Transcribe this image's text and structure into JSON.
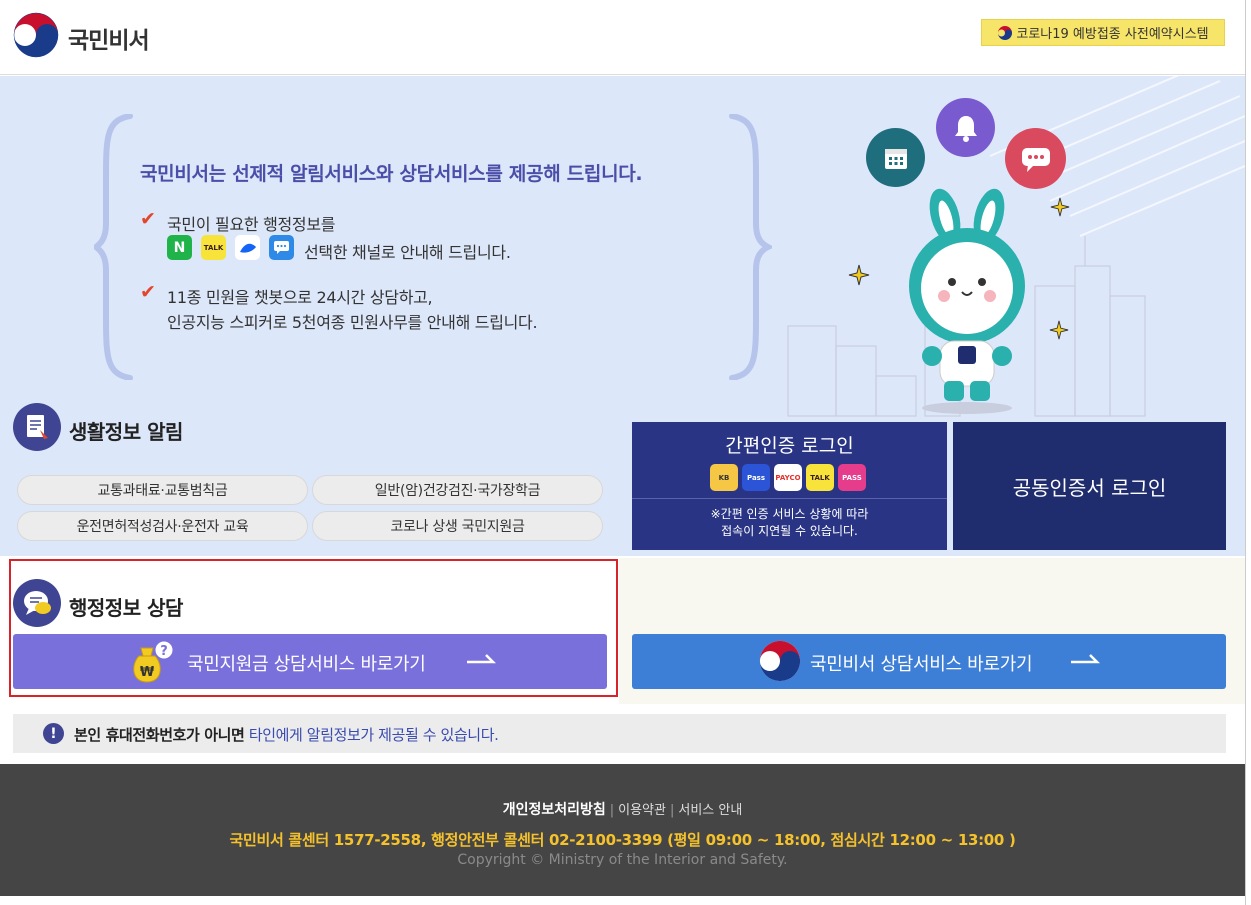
{
  "header": {
    "logo_text": "국민비서",
    "covid_button": "코로나19 예방접종 사전예약시스템"
  },
  "hero": {
    "title": "국민비서는 선제적 알림서비스와 상담서비스를 제공해 드립니다.",
    "point1_line1": "국민이 필요한 행정정보를",
    "point1_line2": "선택한 채널로 안내해 드립니다.",
    "point2_line1": "11종 민원을 챗봇으로 24시간 상담하고,",
    "point2_line2": "인공지능 스피커로 5천여종 민원사무를 안내해 드립니다.",
    "channels": [
      {
        "icon": "naver-icon",
        "glyph": "N",
        "color": "#1fb34a"
      },
      {
        "icon": "kakaotalk-icon",
        "glyph": "TALK",
        "color": "#f7e33a"
      },
      {
        "icon": "toss-icon",
        "glyph": "",
        "color": "#ffffff"
      },
      {
        "icon": "message-icon",
        "glyph": "···",
        "color": "#2e8ae6"
      }
    ]
  },
  "life_info": {
    "title": "생활정보 알림",
    "items": [
      "교통과태료·교통범칙금",
      "일반(암)건강검진·국가장학금",
      "운전면허적성검사·운전자 교육",
      "코로나 상생 국민지원금"
    ]
  },
  "login": {
    "simple_title": "간편인증 로그인",
    "simple_note_line1": "※간편 인증 서비스 상황에 따라",
    "simple_note_line2": "접속이 지연될 수 있습니다.",
    "providers": [
      {
        "label": "KB",
        "bg": "#f6c744",
        "fg": "#333"
      },
      {
        "label": "Pass",
        "bg": "#2b55d6",
        "fg": "#fff"
      },
      {
        "label": "PAYCO",
        "bg": "#ffffff",
        "fg": "#e4312b"
      },
      {
        "label": "TALK",
        "bg": "#f7e33a",
        "fg": "#3a1d1d"
      },
      {
        "label": "PASS",
        "bg": "#e63c8c",
        "fg": "#fff"
      }
    ],
    "cert_title": "공동인증서 로그인"
  },
  "consult": {
    "title": "행정정보 상담",
    "support_button": "국민지원금 상담서비스 바로가기",
    "secretary_button": "국민비서 상담서비스 바로가기"
  },
  "notice": {
    "bold_part": "본인 휴대전화번호가 아니면",
    "blue_part": "타인에게 알림정보가 제공될 수 있습니다."
  },
  "footer": {
    "privacy": "개인정보처리방침",
    "terms": "이용약관",
    "service_guide": "서비스 안내",
    "call_center": "국민비서 콜센터 1577-2558, 행정안전부 콜센터 02-2100-3399 (평일 09:00 ~ 18:00, 점심시간 12:00 ~ 13:00 )",
    "copyright": "Copyright © Ministry of the Interior and Safety."
  },
  "colors": {
    "hero_bg": "#dde7fa",
    "title_blue": "#4a4ea8",
    "accent_red": "#e2462c",
    "purple_button": "#7a70dc",
    "blue_button": "#3d7ed6",
    "login_navy": "#293584",
    "footer_yellow": "#f6c22c"
  }
}
